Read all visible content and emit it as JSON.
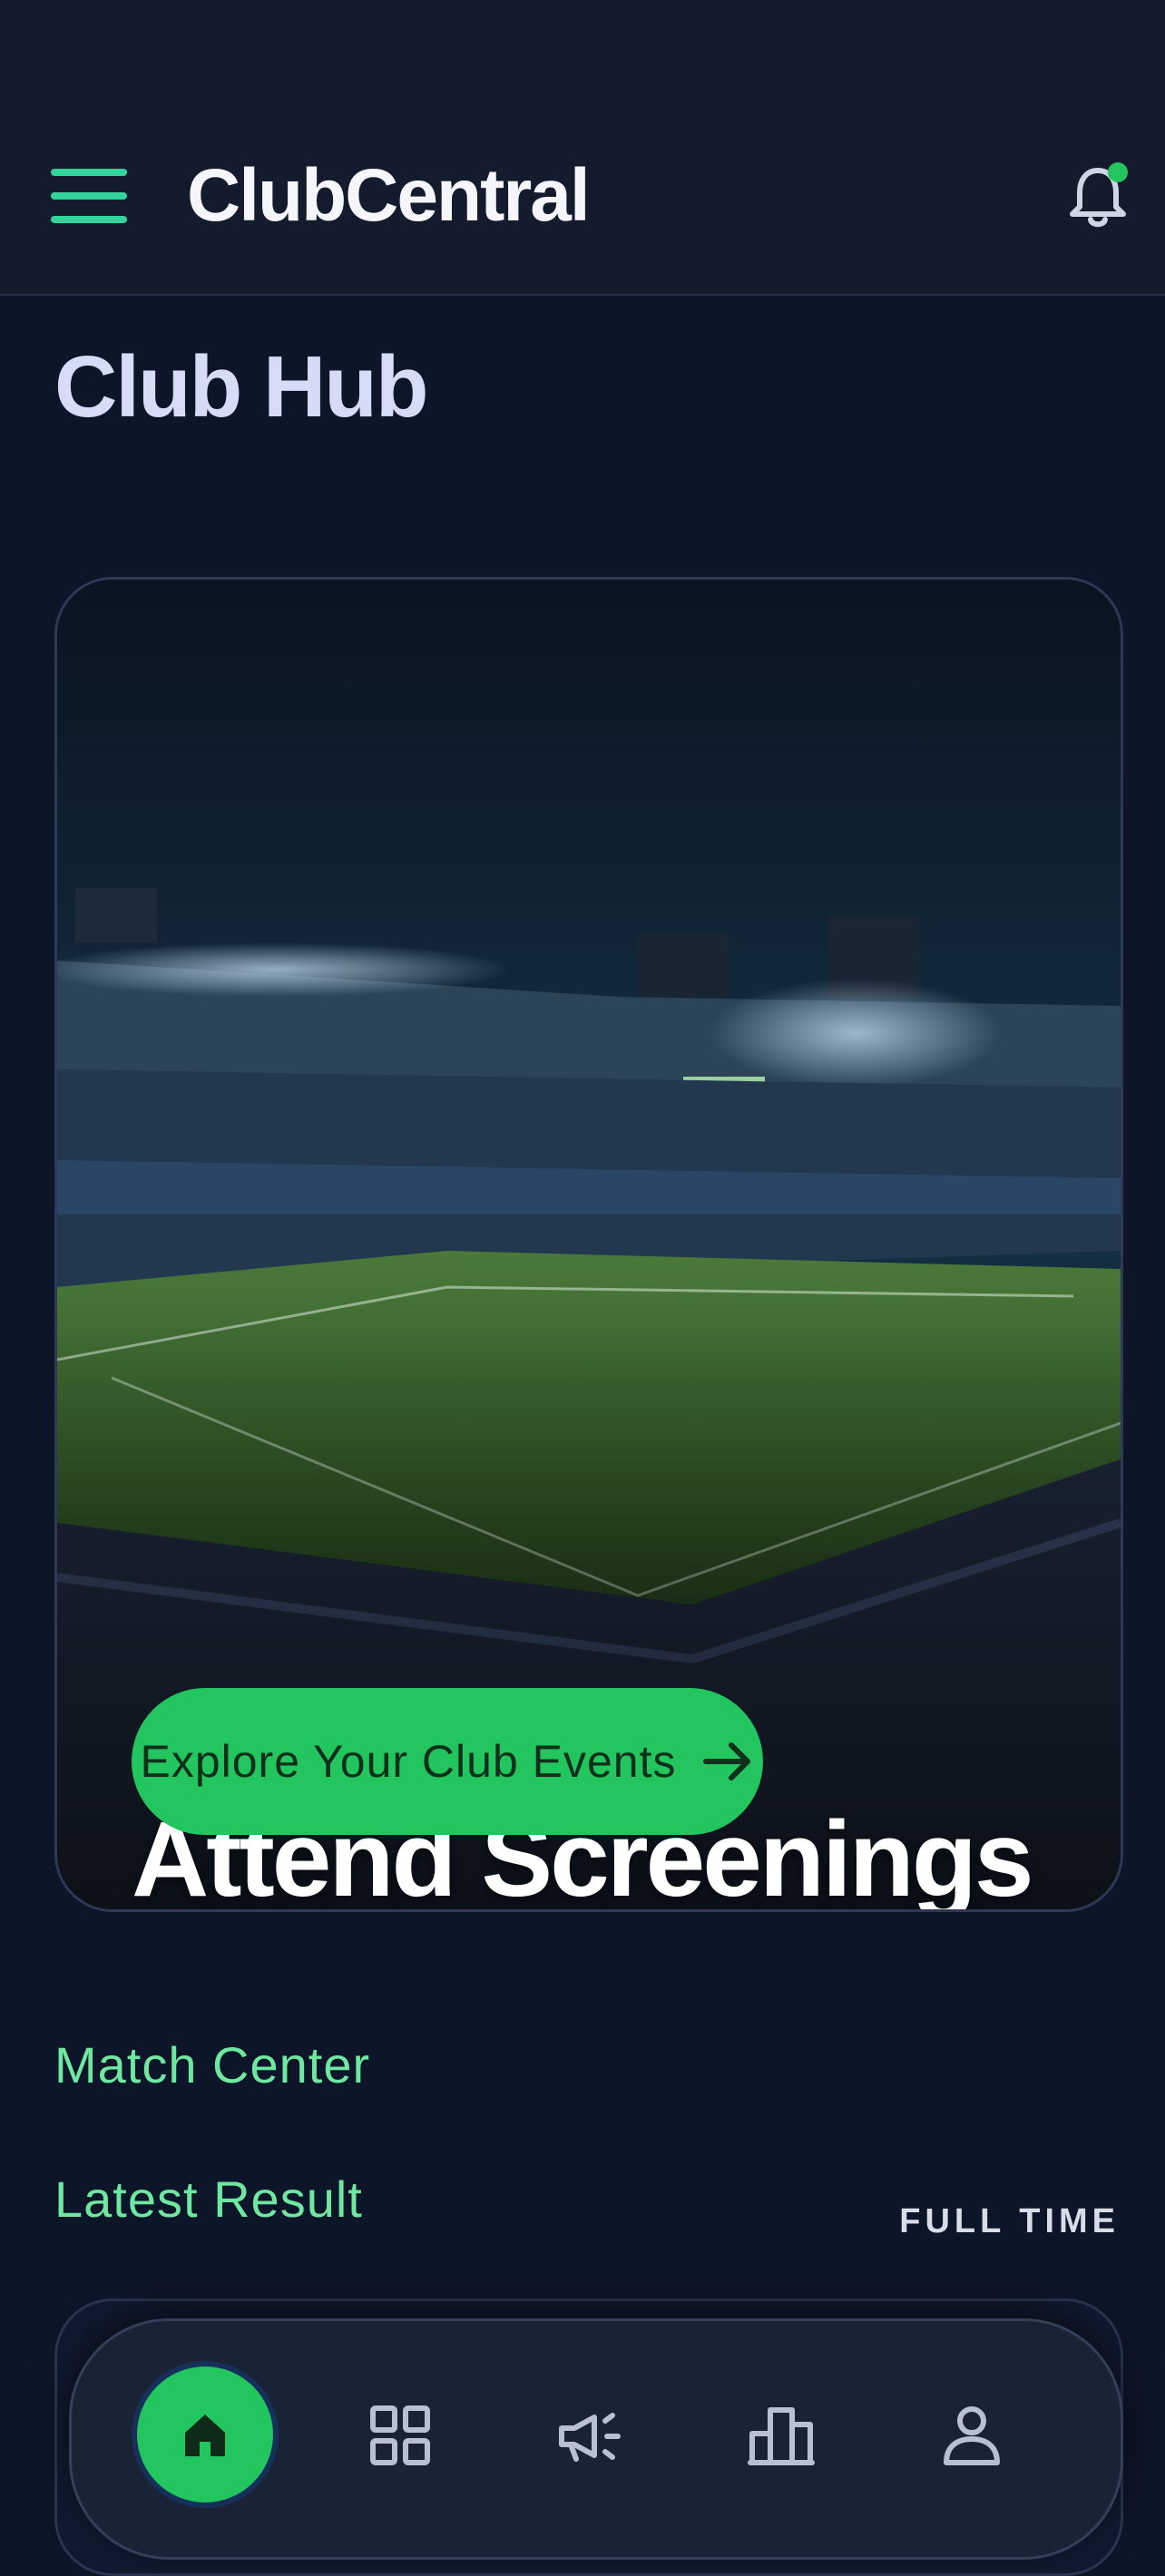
{
  "header": {
    "app_title": "ClubCentral",
    "icons": [
      "menu-icon",
      "bell-icon"
    ],
    "notification_dot_color": "#22c55e"
  },
  "page": {
    "title": "Club Hub"
  },
  "hero": {
    "heading": "Attend Screenings & Events",
    "cta_label": "Explore Your Club Events",
    "cta_icon": "arrow-right-icon",
    "background": "stadium night photo"
  },
  "match_center": {
    "section_label": "Match Center",
    "latest_label": "Latest Result",
    "status": "FULL TIME"
  },
  "bottom_nav": {
    "items": [
      {
        "icon": "home-icon",
        "active": true
      },
      {
        "icon": "grid-icon",
        "active": false
      },
      {
        "icon": "megaphone-icon",
        "active": false
      },
      {
        "icon": "leaderboard-icon",
        "active": false
      },
      {
        "icon": "profile-icon",
        "active": false
      }
    ]
  },
  "colors": {
    "accent": "#22c55e",
    "background": "#0d1528",
    "header": "#141b2c",
    "label": "#6ee7a0"
  }
}
